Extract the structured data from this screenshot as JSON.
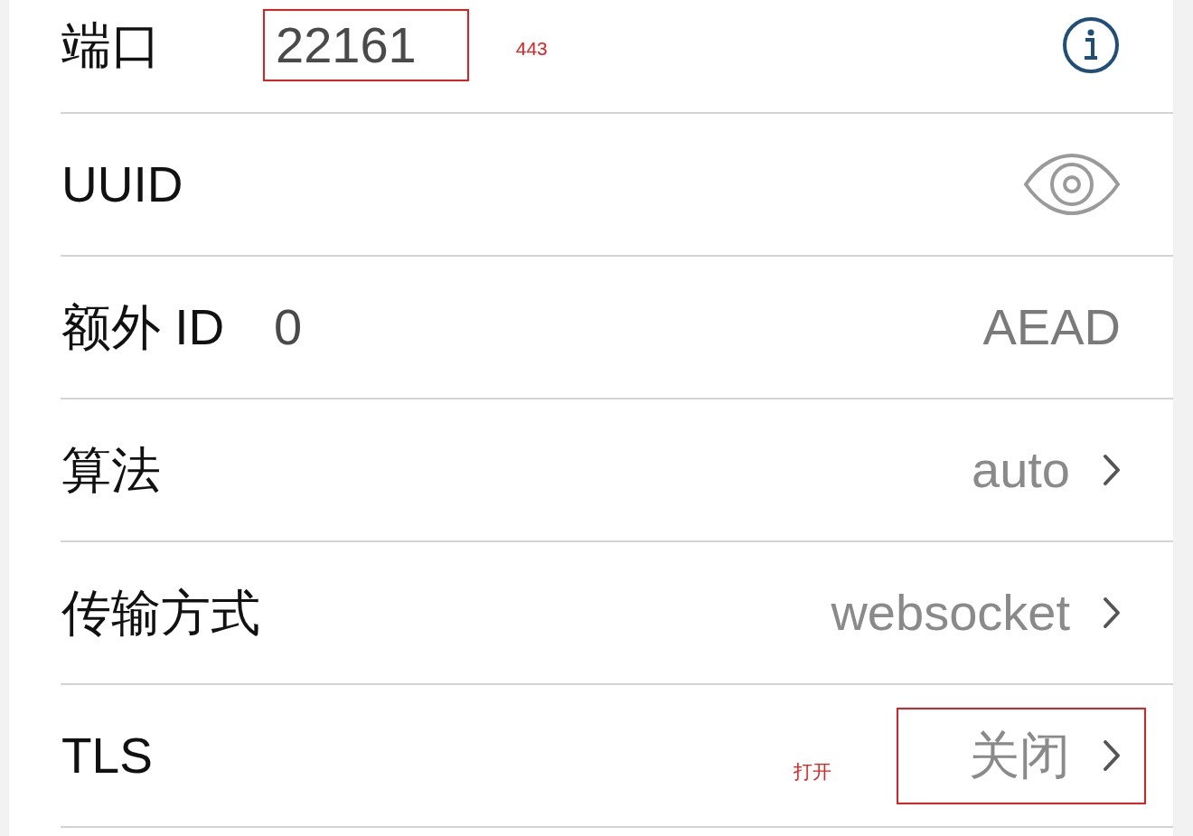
{
  "rows": [
    {
      "label": "端口",
      "value": "22161",
      "value_highlighted": true,
      "note": "443",
      "accessory": {
        "kind": "info"
      }
    },
    {
      "label": "UUID",
      "accessory": {
        "kind": "eye"
      }
    },
    {
      "label": "额外 ID",
      "value": "0",
      "value_highlighted": false,
      "detail": "AEAD",
      "detail_highlighted": false
    },
    {
      "label": "算法",
      "detail": "auto",
      "detail_highlighted": false,
      "accessory": {
        "kind": "chevron"
      }
    },
    {
      "label": "传输方式",
      "detail": "websocket",
      "detail_highlighted": false,
      "accessory": {
        "kind": "chevron"
      }
    },
    {
      "label": "TLS",
      "note": "打开",
      "detail": "关闭",
      "detail_highlighted": true,
      "accessory": {
        "kind": "chevron"
      }
    }
  ]
}
